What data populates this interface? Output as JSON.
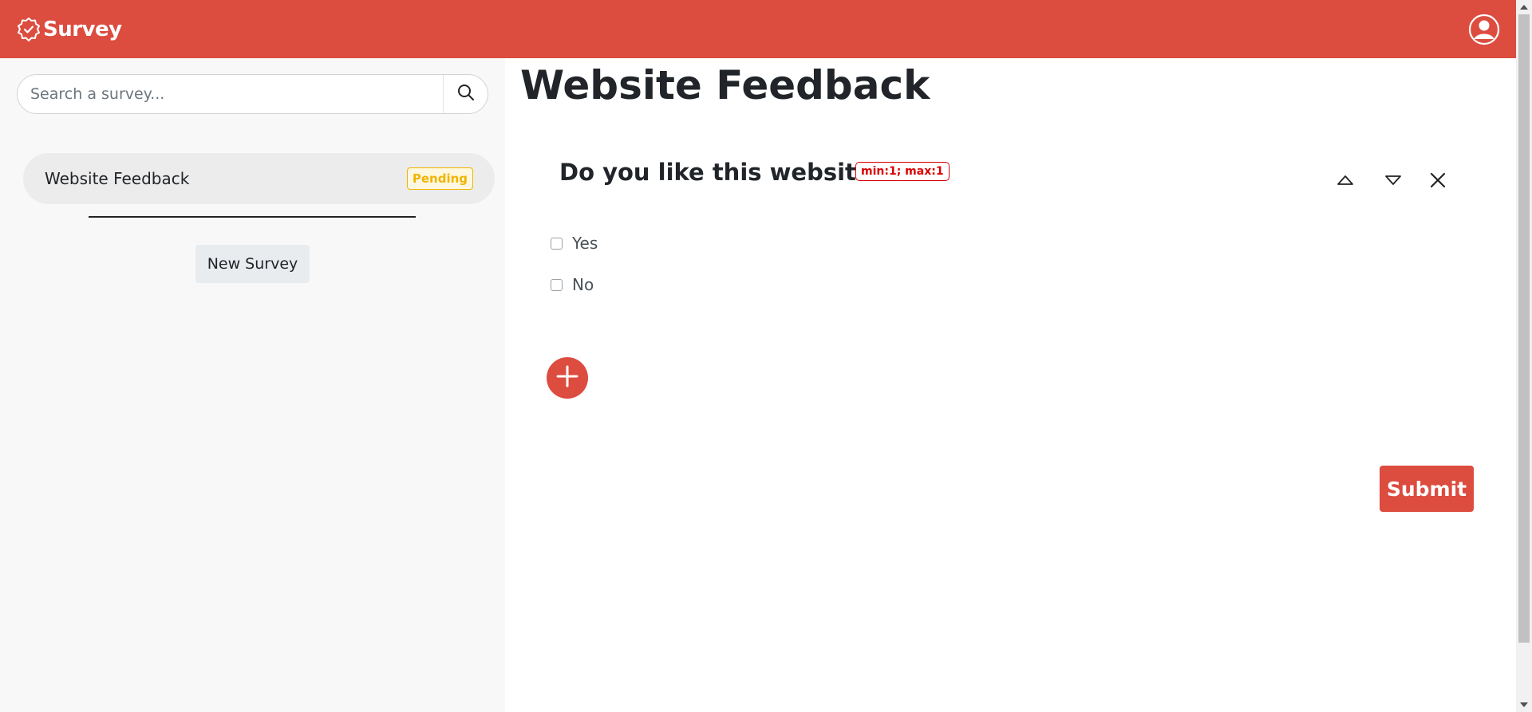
{
  "header": {
    "brand": "Survey",
    "brand_icon": "badge-check-icon",
    "user_icon": "user-circle-icon",
    "accent_color": "#dc4c3f"
  },
  "sidebar": {
    "search": {
      "placeholder": "Search a survey...",
      "value": ""
    },
    "surveys": [
      {
        "label": "Website Feedback",
        "status": "Pending"
      }
    ],
    "new_survey_label": "New Survey"
  },
  "main": {
    "title": "Website Feedback",
    "questions": [
      {
        "text": "Do you like this website?",
        "constraint": "min:1; max:1",
        "options": [
          {
            "label": "Yes",
            "checked": false
          },
          {
            "label": "No",
            "checked": false
          }
        ]
      }
    ],
    "submit_label": "Submit"
  }
}
